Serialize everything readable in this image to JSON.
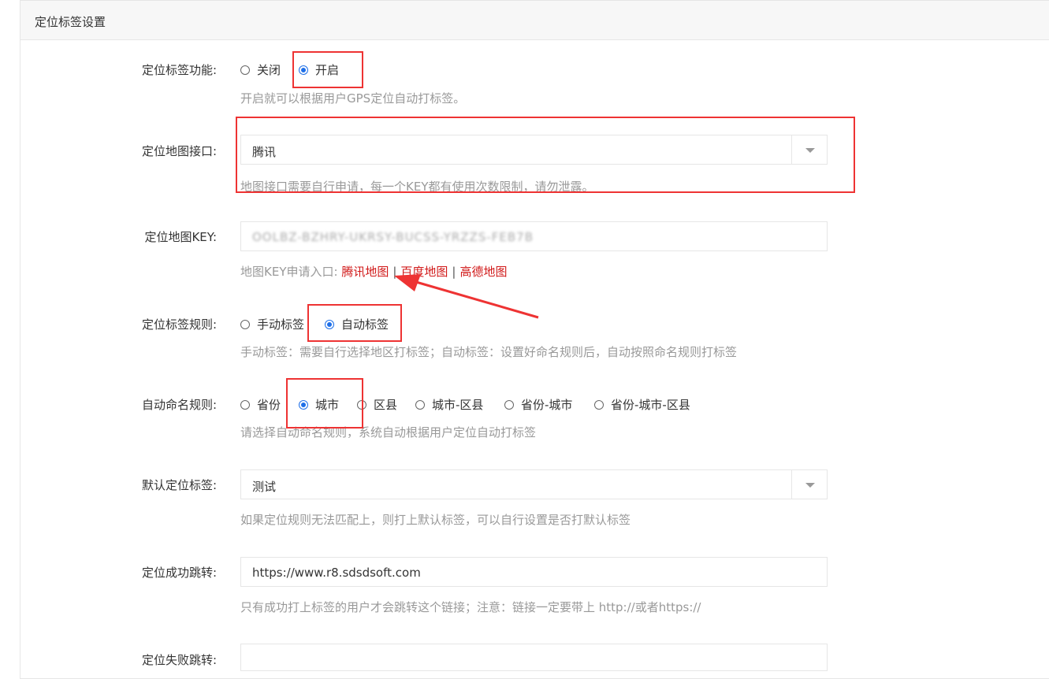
{
  "panel": {
    "title": "定位标签设置"
  },
  "geo_function": {
    "label": "定位标签功能:",
    "options": [
      "关闭",
      "开启"
    ],
    "selected": "开启",
    "help": "开启就可以根据用户GPS定位自动打标签。"
  },
  "map_api": {
    "label": "定位地图接口:",
    "value": "腾讯",
    "help": "地图接口需要自行申请，每一个KEY都有使用次数限制，请勿泄露。"
  },
  "map_key": {
    "label": "定位地图KEY:",
    "value": "OOLBZ-BZHRY-UKRSY-BUCSS-YRZZS-FEB7B",
    "help_prefix": "地图KEY申请入口:",
    "links": [
      "腾讯地图",
      "百度地图",
      "高德地图"
    ],
    "separator": "|"
  },
  "tag_rule": {
    "label": "定位标签规则:",
    "options": [
      "手动标签",
      "自动标签"
    ],
    "selected": "自动标签",
    "help": "手动标签：需要自行选择地区打标签；自动标签：设置好命名规则后，自动按照命名规则打标签"
  },
  "naming_rule": {
    "label": "自动命名规则:",
    "options": [
      "省份",
      "城市",
      "区县",
      "城市-区县",
      "省份-城市",
      "省份-城市-区县"
    ],
    "selected": "城市",
    "help": "请选择自动命名规则，系统自动根据用户定位自动打标签"
  },
  "default_tag": {
    "label": "默认定位标签:",
    "value": "测试",
    "help": "如果定位规则无法匹配上，则打上默认标签，可以自行设置是否打默认标签"
  },
  "success_redirect": {
    "label": "定位成功跳转:",
    "value": "https://www.r8.sdsdsoft.com",
    "help": "只有成功打上标签的用户才会跳转这个链接；注意：链接一定要带上 http://或者https://"
  },
  "fail_redirect": {
    "label": "定位失败跳转:",
    "value": ""
  },
  "colors": {
    "accent": "#1e6fe8",
    "highlight": "#e33333",
    "link": "#d11a1a"
  }
}
